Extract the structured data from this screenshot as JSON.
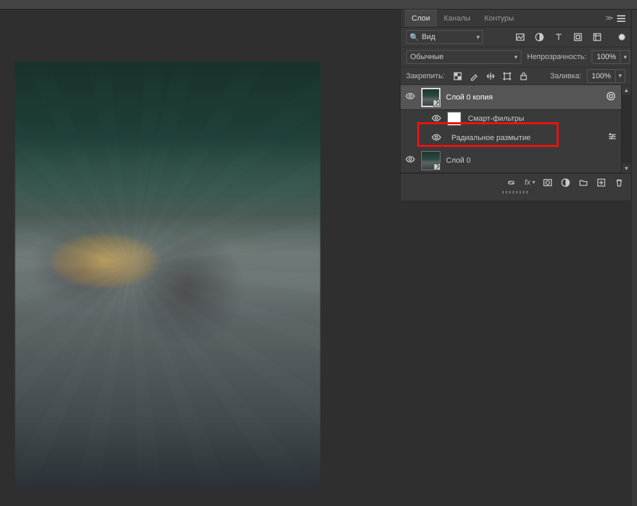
{
  "tabs": {
    "layers": "Слои",
    "channels": "Каналы",
    "paths": "Контуры"
  },
  "search": {
    "kind_label": "Вид"
  },
  "blend": {
    "mode": "Обычные"
  },
  "opacity": {
    "label": "Непрозрачность:",
    "value": "100%"
  },
  "lock": {
    "label": "Закрепить:"
  },
  "fill": {
    "label": "Заливка:",
    "value": "100%"
  },
  "layers": {
    "l0copy": {
      "name": "Слой 0 копия"
    },
    "smart_filters_label": "Смарт-фильтры",
    "radial_blur_label": "Радиальное размытие",
    "l0": {
      "name": "Слой 0"
    }
  }
}
